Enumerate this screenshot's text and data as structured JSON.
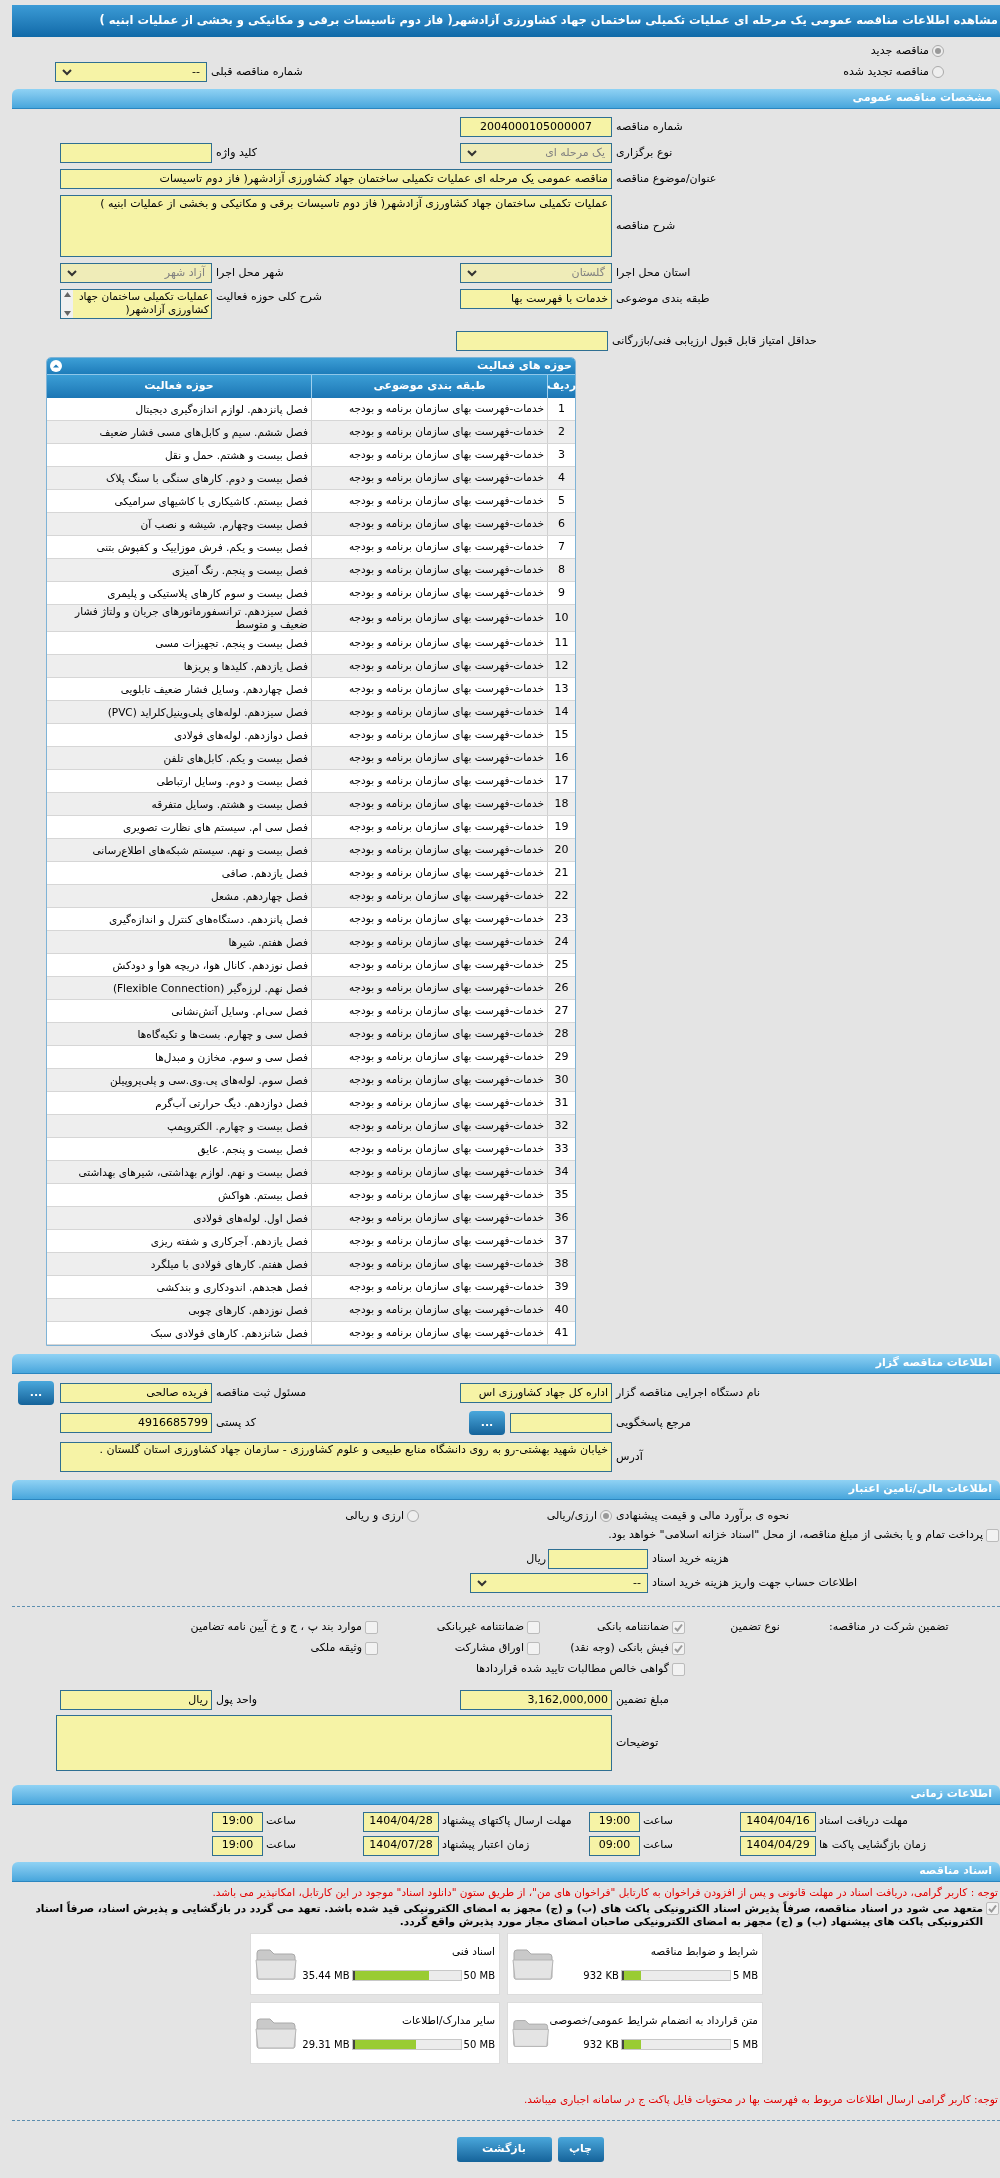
{
  "title": "مشاهده اطلاعات مناقصه عمومی یک مرحله ای عملیات تکمیلی ساختمان جهاد کشاورزی آزادشهر( فاز دوم تاسیسات برقی و مکانیکی و بخشی از عملیات ابنیه )",
  "tender_status": [
    {
      "label": "مناقصه جدید",
      "selected": true
    },
    {
      "label": "مناقصه تجدید شده",
      "selected": false
    }
  ],
  "previous_tender": {
    "label": "شماره مناقصه قبلی",
    "value": "--"
  },
  "general": {
    "heading": "مشخصات مناقصه عمومی",
    "tender_number": {
      "label": "شماره مناقصه",
      "value": "2004000105000007"
    },
    "keyword": {
      "label": "کلید واژه"
    },
    "holding_type": {
      "label": "نوع برگزاری",
      "value": "یک مرحله ای",
      "disabled": true
    },
    "subject": {
      "label": "عنوان/موضوع مناقصه",
      "value": "مناقصه عمومی یک مرحله ای عملیات تکمیلی ساختمان جهاد کشاورزی آزادشهر( فاز دوم تاسیسات"
    },
    "description": {
      "label": "شرح مناقصه",
      "value": "عملیات تکمیلی ساختمان جهاد کشاورزی آزادشهر( فاز دوم تاسیسات برقی و مکانیکی و بخشی از عملیات ابنیه )"
    },
    "province": {
      "label": "استان محل اجرا",
      "value": "گلستان",
      "disabled": true
    },
    "city": {
      "label": "شهر محل اجرا",
      "value": "آزاد شهر",
      "disabled": true
    },
    "category": {
      "label": "طبقه بندی موضوعی",
      "value": "خدمات با فهرست بها"
    },
    "activity_description": {
      "label": "شرح کلی حوزه فعالیت",
      "value": "عملیات تکمیلی ساختمان جهاد کشاورزی آزادشهر("
    },
    "min_score": {
      "label": "حداقل امتیاز قابل قبول ارزیابی فنی/بازرگانی"
    }
  },
  "activities": {
    "title": "حوزه های فعالیت",
    "columns": [
      "ردیف",
      "طبقه بندی موضوعی",
      "حوزه فعالیت"
    ],
    "rows": [
      [
        "1",
        "خدمات-فهرست بهای سازمان برنامه و بودجه",
        "فصل پانزدهم. لوازم اندازه‌گیری دیجیتال"
      ],
      [
        "2",
        "خدمات-فهرست بهای سازمان برنامه و بودجه",
        "فصل ششم. سیم و کابل‌های مسی فشار ضعیف"
      ],
      [
        "3",
        "خدمات-فهرست بهای سازمان برنامه و بودجه",
        "فصل بیست و هشتم. حمل و نقل"
      ],
      [
        "4",
        "خدمات-فهرست بهای سازمان برنامه و بودجه",
        "فصل بیست و دوم. کارهای سنگی با سنگ پلاک"
      ],
      [
        "5",
        "خدمات-فهرست بهای سازمان برنامه و بودجه",
        "فصل بیستم. کاشیکاری با کاشیهای سرامیکی"
      ],
      [
        "6",
        "خدمات-فهرست بهای سازمان برنامه و بودجه",
        "فصل بیست وچهارم. شیشه و نصب آن"
      ],
      [
        "7",
        "خدمات-فهرست بهای سازمان برنامه و بودجه",
        "فصل بیست و یکم. فرش موزاییک و کفپوش بتنی"
      ],
      [
        "8",
        "خدمات-فهرست بهای سازمان برنامه و بودجه",
        "فصل بیست و پنجم. رنگ آمیزی"
      ],
      [
        "9",
        "خدمات-فهرست بهای سازمان برنامه و بودجه",
        "فصل بیست و سوم کارهای پلاستیکی و پلیمری"
      ],
      [
        "10",
        "خدمات-فهرست بهای سازمان برنامه و بودجه",
        "فصل سیزدهم. ترانسفورماتورهای جریان و ولتاژ فشار ضعیف و متوسط"
      ],
      [
        "11",
        "خدمات-فهرست بهای سازمان برنامه و بودجه",
        "فصل بیست و پنجم. تجهیزات مسی"
      ],
      [
        "12",
        "خدمات-فهرست بهای سازمان برنامه و بودجه",
        "فصل یازدهم. کلیدها و پریزها"
      ],
      [
        "13",
        "خدمات-فهرست بهای سازمان برنامه و بودجه",
        "فصل چهاردهم. وسایل فشار ضعیف تابلویی"
      ],
      [
        "14",
        "خدمات-فهرست بهای سازمان برنامه و بودجه",
        "فصل سیزدهم. لوله‌های پلی‌وینیل‌کلراید (PVC)"
      ],
      [
        "15",
        "خدمات-فهرست بهای سازمان برنامه و بودجه",
        "فصل دوازدهم. لوله‌های فولادی"
      ],
      [
        "16",
        "خدمات-فهرست بهای سازمان برنامه و بودجه",
        "فصل بیست و یکم. کابل‌های تلفن"
      ],
      [
        "17",
        "خدمات-فهرست بهای سازمان برنامه و بودجه",
        "فصل بیست و دوم. وسایل ارتباطی"
      ],
      [
        "18",
        "خدمات-فهرست بهای سازمان برنامه و بودجه",
        "فصل بیست و هشتم. وسایل متفرقه"
      ],
      [
        "19",
        "خدمات-فهرست بهای سازمان برنامه و بودجه",
        "فصل سی ام. سیستم های نظارت تصویری"
      ],
      [
        "20",
        "خدمات-فهرست بهای سازمان برنامه و بودجه",
        "فصل بیست و نهم. سیستم شبکه‌های اطلاع‌رسانی"
      ],
      [
        "21",
        "خدمات-فهرست بهای سازمان برنامه و بودجه",
        "فصل یازدهم. صافی"
      ],
      [
        "22",
        "خدمات-فهرست بهای سازمان برنامه و بودجه",
        "فصل چهاردهم. مشعل"
      ],
      [
        "23",
        "خدمات-فهرست بهای سازمان برنامه و بودجه",
        "فصل پانزدهم. دستگاه‌های کنترل و اندازه‌گیری"
      ],
      [
        "24",
        "خدمات-فهرست بهای سازمان برنامه و بودجه",
        "فصل هفتم. شیرها"
      ],
      [
        "25",
        "خدمات-فهرست بهای سازمان برنامه و بودجه",
        "فصل نوزدهم. کانال هوا، دریچه هوا و دودکش"
      ],
      [
        "26",
        "خدمات-فهرست بهای سازمان برنامه و بودجه",
        "فصل نهم. لرزه‌گیر (Flexible Connection)"
      ],
      [
        "27",
        "خدمات-فهرست بهای سازمان برنامه و بودجه",
        "فصل سی‌ام. وسایل آتش‌نشانی"
      ],
      [
        "28",
        "خدمات-فهرست بهای سازمان برنامه و بودجه",
        "فصل سی و چهارم. بست‌ها و تکیه‌گاه‌ها"
      ],
      [
        "29",
        "خدمات-فهرست بهای سازمان برنامه و بودجه",
        "فصل سی و سوم. مخازن و مبدل‌ها"
      ],
      [
        "30",
        "خدمات-فهرست بهای سازمان برنامه و بودجه",
        "فصل سوم. لوله‌های پی.وی.سی و پلی‌پروپیلن"
      ],
      [
        "31",
        "خدمات-فهرست بهای سازمان برنامه و بودجه",
        "فصل دوازدهم. دیگ حرارتی آب‌گرم"
      ],
      [
        "32",
        "خدمات-فهرست بهای سازمان برنامه و بودجه",
        "فصل بیست و چهارم. الکتروپمپ"
      ],
      [
        "33",
        "خدمات-فهرست بهای سازمان برنامه و بودجه",
        "فصل بیست و پنجم. عایق"
      ],
      [
        "34",
        "خدمات-فهرست بهای سازمان برنامه و بودجه",
        "فصل بیست و نهم. لوازم بهداشتی، شیرهای بهداشتی"
      ],
      [
        "35",
        "خدمات-فهرست بهای سازمان برنامه و بودجه",
        "فصل بیستم. هواکش"
      ],
      [
        "36",
        "خدمات-فهرست بهای سازمان برنامه و بودجه",
        "فصل اول. لوله‌های فولادی"
      ],
      [
        "37",
        "خدمات-فهرست بهای سازمان برنامه و بودجه",
        "فصل یازدهم. آجرکاری و شفته ریزی"
      ],
      [
        "38",
        "خدمات-فهرست بهای سازمان برنامه و بودجه",
        "فصل هفتم. کارهای فولادی با میلگرد"
      ],
      [
        "39",
        "خدمات-فهرست بهای سازمان برنامه و بودجه",
        "فصل هجدهم. اندودکاری و بندکشی"
      ],
      [
        "40",
        "خدمات-فهرست بهای سازمان برنامه و بودجه",
        "فصل نوزدهم. کارهای چوبی"
      ],
      [
        "41",
        "خدمات-فهرست بهای سازمان برنامه و بودجه",
        "فصل شانزدهم. کارهای فولادی سبک"
      ]
    ]
  },
  "contractor": {
    "heading": "اطلاعات مناقصه گزار",
    "agency": {
      "label": "نام دستگاه اجرایی مناقصه گزار",
      "value": "اداره کل جهاد کشاورزی اس"
    },
    "registrar": {
      "label": "مسئول ثبت مناقصه",
      "value": "فریده  صالحی",
      "button": "..."
    },
    "reference": {
      "label": "مرجع پاسخگویی",
      "button": "..."
    },
    "postal_code": {
      "label": "کد پستی",
      "value": "4916685799"
    },
    "address": {
      "label": "آدرس",
      "value": "خیابان شهید بهشتی-رو به روی دانشگاه منابع طبیعی و علوم کشاورزی - سازمان جهاد کشاورزی استان گلستان ."
    }
  },
  "finance": {
    "heading": "اطلاعات مالی/تامین اعتبار",
    "estimate": {
      "label": "نحوه ی برآورد مالی و قیمت پیشنهادی",
      "options": [
        {
          "label": "ارزی/ریالی",
          "selected": true
        },
        {
          "label": "ارزی و ریالی",
          "selected": false
        }
      ]
    },
    "treasury": {
      "label": "پرداخت تمام و یا بخشی از مبلغ مناقصه، از محل \"اسناد خزانه اسلامی\" خواهد بود.",
      "checked": false
    },
    "document_fee": {
      "label": "هزینه خرید اسناد",
      "unit": "ریال"
    },
    "account": {
      "label": "اطلاعات حساب جهت واریز هزینه خرید اسناد",
      "value": "--"
    },
    "guarantee": {
      "label": "تضمین شرکت در مناقصه:",
      "type_label": "نوع تضمین",
      "options": [
        {
          "label": "ضمانتنامه بانکی",
          "checked": true
        },
        {
          "label": "ضمانتنامه غیربانکی",
          "checked": false
        },
        {
          "label": "موارد بند پ ، ج و خ آیین نامه تضامین",
          "checked": false
        },
        {
          "label": "فیش بانکی (وجه نقد)",
          "checked": true
        },
        {
          "label": "اوراق مشارکت",
          "checked": false
        },
        {
          "label": "وثیقه ملکی",
          "checked": false
        },
        {
          "label": "گواهی خالص مطالبات تایید شده قراردادها",
          "checked": false
        }
      ]
    },
    "amount": {
      "label": "مبلغ تضمین",
      "value": "3,162,000,000"
    },
    "currency": {
      "label": "واحد پول",
      "value": "ریال"
    },
    "notes": {
      "label": "توضیحات"
    }
  },
  "timing": {
    "heading": "اطلاعات زمانی",
    "items": [
      {
        "label": "مهلت دریافت اسناد",
        "date": "1404/04/16",
        "time_label": "ساعت",
        "time": "19:00"
      },
      {
        "label": "مهلت ارسال پاکتهای پیشنهاد",
        "date": "1404/04/28",
        "time_label": "ساعت",
        "time": "19:00"
      },
      {
        "label": "زمان بازگشایی پاکت ها",
        "date": "1404/04/29",
        "time_label": "ساعت",
        "time": "09:00"
      },
      {
        "label": "زمان اعتبار پیشنهاد",
        "date": "1404/07/28",
        "time_label": "ساعت",
        "time": "19:00"
      }
    ]
  },
  "documents": {
    "heading": "اسناد مناقصه",
    "notice": "توجه : کاربر گرامی، دریافت اسناد در مهلت قانونی و پس از افزودن فراخوان به کارتابل \"فراخوان های من\"، از طریق ستون \"دانلود اسناد\" موجود در این کارتابل، امکانپذیر می باشد.",
    "commitment": {
      "text": "متعهد می شود در اسناد مناقصه، صرفاً پذیرش اسناد الکترونیکی پاکت های (ب) و (ج) مجهز به امضای الکترونیکی قید شده باشد. تعهد می گردد در بازگشایی و پذیرش اسناد، صرفاً اسناد الکترونیکی پاکت های پیشنهاد (ب) و (ج) مجهز به امضای الکترونیکی صاحبان امضای مجاز مورد پذیرش واقع گردد.",
      "checked": true
    },
    "files": [
      {
        "title": "شرایط و ضوابط مناقصه",
        "max": "5 MB",
        "used": "932 KB",
        "level": 0.18
      },
      {
        "title": "اسناد فنی",
        "max": "50 MB",
        "used": "35.44 MB",
        "level": 0.71
      },
      {
        "title": "متن قرارداد به انضمام شرایط عمومی/خصوصی",
        "max": "5 MB",
        "used": "932 KB",
        "level": 0.18
      },
      {
        "title": "سایر مدارک/اطلاعات",
        "max": "50 MB",
        "used": "29.31 MB",
        "level": 0.59
      }
    ],
    "footer_note": "توجه: کاربر گرامی ارسال اطلاعات مربوط به فهرست بها در محتویات فایل پاکت ج در سامانه اجباری میباشد."
  },
  "buttons": [
    "چاپ",
    "بازگشت"
  ]
}
